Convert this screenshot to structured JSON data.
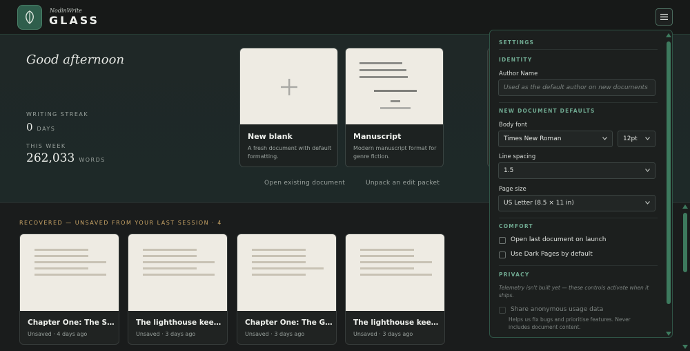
{
  "app": {
    "brand_small": "NodinWrite",
    "brand_big": "GLASS"
  },
  "hero": {
    "greeting": "Good afternoon",
    "streak_label": "WRITING STREAK",
    "streak_value": "0",
    "streak_unit": "DAYS",
    "week_label": "THIS WEEK",
    "week_value": "262,033",
    "week_unit": "WORDS",
    "templates": [
      {
        "title": "New blank",
        "desc": "A fresh document with default formatting."
      },
      {
        "title": "Manuscript",
        "desc": "Modern manuscript format for genre fiction."
      }
    ],
    "open_link": "Open existing document",
    "unpack_link": "Unpack an edit packet"
  },
  "recovered": {
    "label": "RECOVERED — UNSAVED FROM YOUR LAST SESSION",
    "count": "· 4",
    "items": [
      {
        "title": "Chapter One: The Storm",
        "sub": "Unsaved · 4 days ago"
      },
      {
        "title": "The lighthouse keeper ...",
        "sub": "Unsaved · 3 days ago"
      },
      {
        "title": "Chapter One: The Gat...",
        "sub": "Unsaved · 3 days ago"
      },
      {
        "title": "The lighthouse keeper ...",
        "sub": "Unsaved · 3 days ago"
      }
    ]
  },
  "settings": {
    "title": "SETTINGS",
    "identity_label": "IDENTITY",
    "author_label": "Author Name",
    "author_placeholder": "Used as the default author on new documents",
    "defaults_label": "NEW DOCUMENT DEFAULTS",
    "body_font_label": "Body font",
    "body_font_value": "Times New Roman",
    "font_size_value": "12pt",
    "line_spacing_label": "Line spacing",
    "line_spacing_value": "1.5",
    "page_size_label": "Page size",
    "page_size_value": "US Letter (8.5 × 11 in)",
    "comfort_label": "COMFORT",
    "open_last_label": "Open last document on launch",
    "dark_pages_label": "Use Dark Pages by default",
    "privacy_label": "PRIVACY",
    "privacy_note": "Telemetry isn't built yet — these controls activate when it ships.",
    "share_label": "Share anonymous usage data",
    "share_note": "Helps us fix bugs and prioritise features. Never includes document content."
  },
  "colors": {
    "accent": "#3d7a5e",
    "recovered": "#c9a567",
    "paper": "#eeebe3"
  }
}
